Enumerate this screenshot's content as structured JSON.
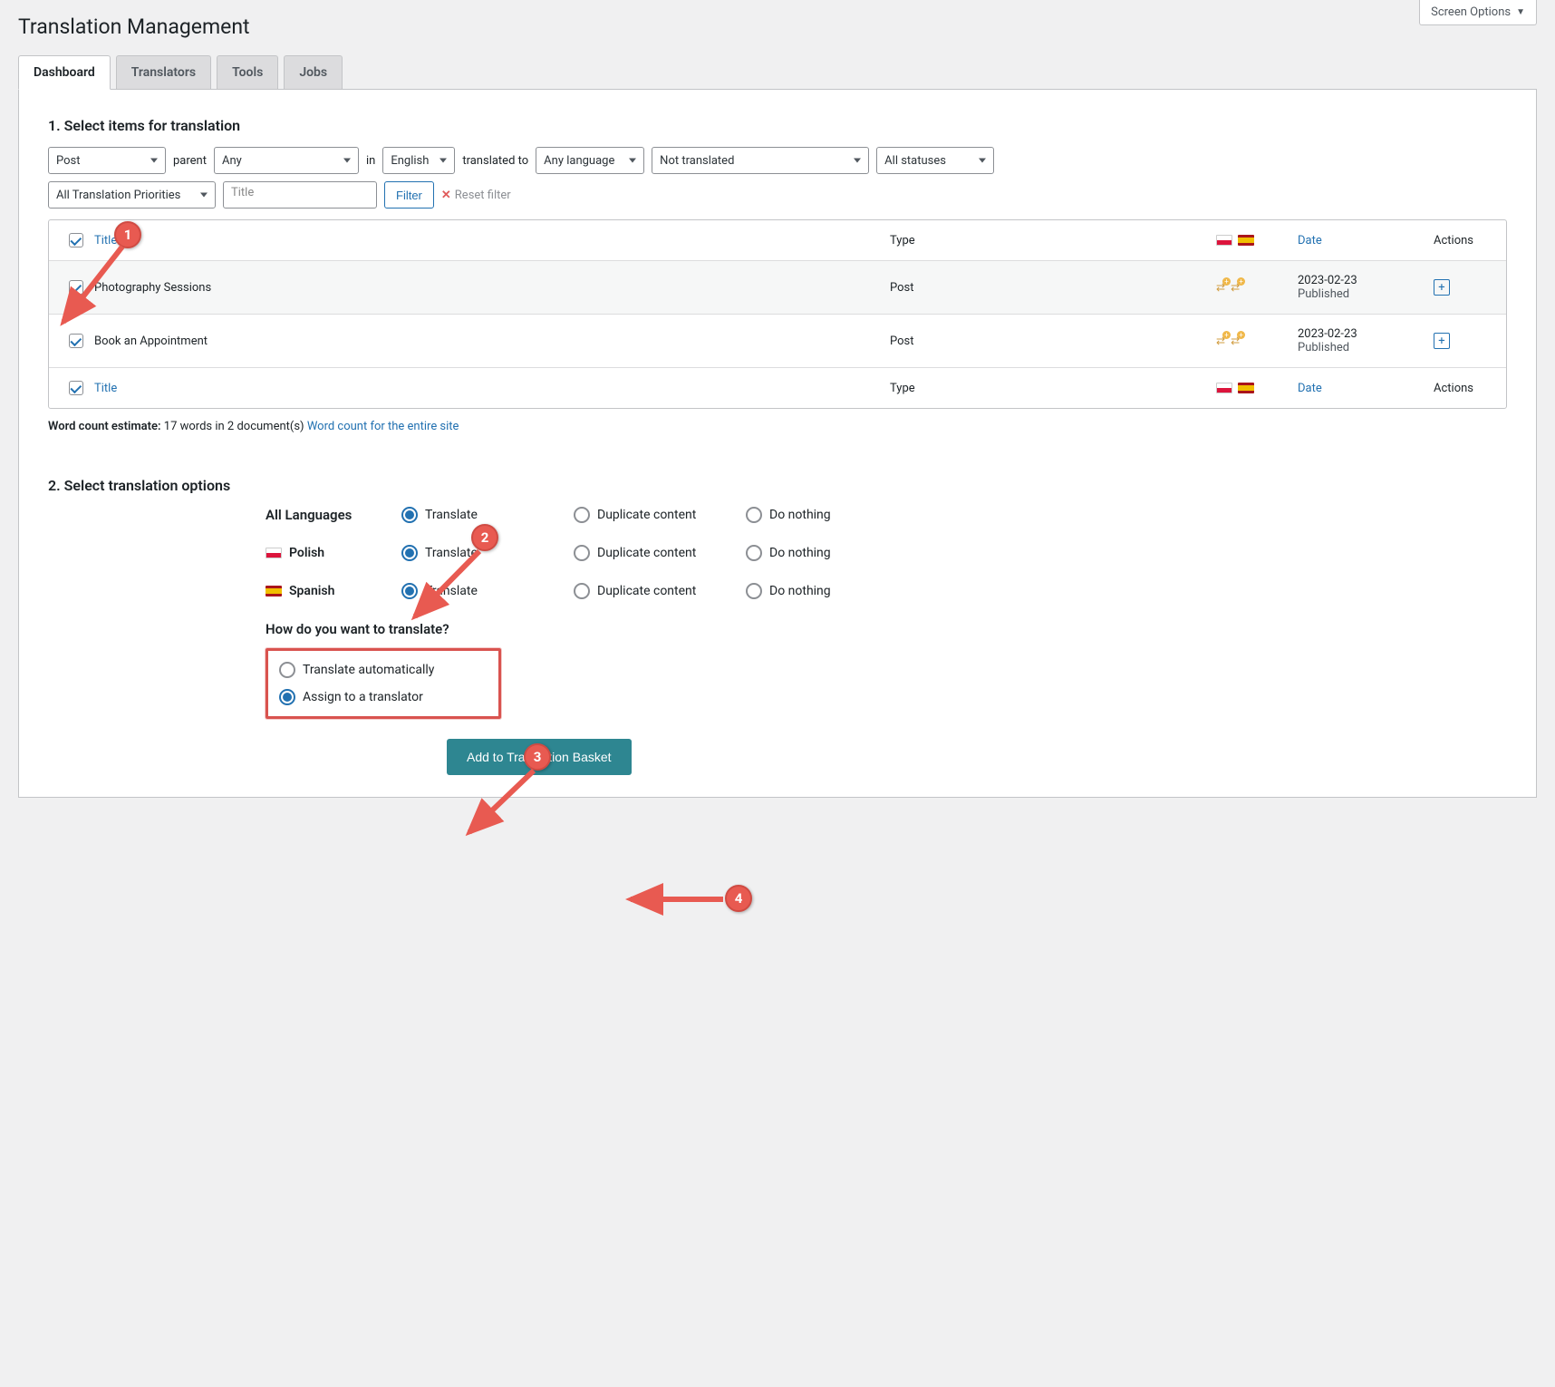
{
  "page_title": "Translation Management",
  "screen_options": "Screen Options",
  "tabs": [
    "Dashboard",
    "Translators",
    "Tools",
    "Jobs"
  ],
  "active_tab": 0,
  "section1_heading": "1. Select items for translation",
  "filters": {
    "type": "Post",
    "parent_label": "parent",
    "parent": "Any",
    "in_label": "in",
    "language": "English",
    "translated_to_label": "translated to",
    "target_lang": "Any language",
    "translation_status": "Not translated",
    "status": "All statuses",
    "priorities": "All Translation Priorities",
    "title_placeholder": "Title",
    "filter_btn": "Filter",
    "reset": "Reset filter"
  },
  "table": {
    "headers": {
      "title": "Title",
      "type": "Type",
      "date": "Date",
      "actions": "Actions"
    },
    "rows": [
      {
        "title": "Photography Sessions",
        "type": "Post",
        "date": "2023-02-23",
        "status": "Published"
      },
      {
        "title": "Book an Appointment",
        "type": "Post",
        "date": "2023-02-23",
        "status": "Published"
      }
    ]
  },
  "wordcount": {
    "label": "Word count estimate:",
    "text": "17 words in 2 document(s)",
    "link": "Word count for the entire site"
  },
  "section2_heading": "2. Select translation options",
  "opt_labels": {
    "all": "All Languages",
    "polish": "Polish",
    "spanish": "Spanish",
    "translate": "Translate",
    "duplicate": "Duplicate content",
    "nothing": "Do nothing"
  },
  "how": {
    "question": "How do you want to translate?",
    "auto": "Translate automatically",
    "assign": "Assign to a translator"
  },
  "add_button": "Add to Translation Basket",
  "annotations": {
    "1": "1",
    "2": "2",
    "3": "3",
    "4": "4"
  }
}
